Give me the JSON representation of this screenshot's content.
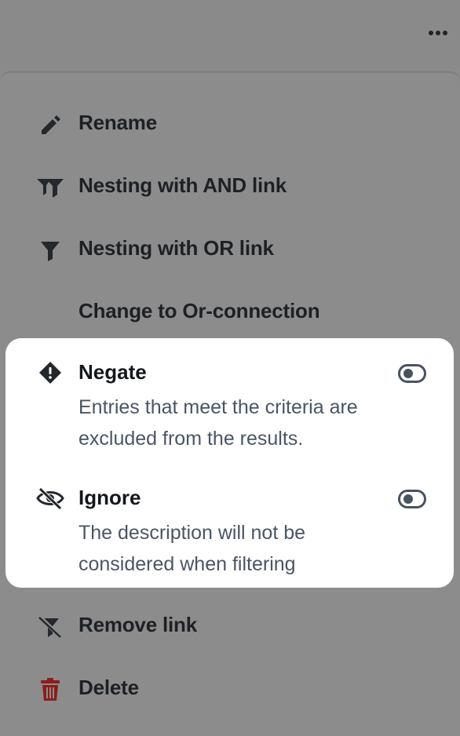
{
  "header": {
    "more_icon": "more-horizontal-icon"
  },
  "menu": {
    "items": [
      {
        "label": "Rename",
        "icon": "pencil-icon"
      },
      {
        "label": "Nesting with AND link",
        "icon": "double-filter-icon"
      },
      {
        "label": "Nesting with OR link",
        "icon": "filter-icon"
      },
      {
        "label": "Change to Or-connection",
        "icon": ""
      }
    ],
    "toggles": [
      {
        "title": "Negate",
        "description": "Entries that meet the criteria are excluded from the results.",
        "icon": "exclamation-diamond-icon",
        "enabled": false
      },
      {
        "title": "Ignore",
        "description": "The description will not be considered when filtering",
        "icon": "eye-slash-icon",
        "enabled": false
      }
    ],
    "bottom_items": [
      {
        "label": "Remove link",
        "icon": "filter-slash-icon"
      },
      {
        "label": "Delete",
        "icon": "trash-icon",
        "color": "#8c1d1a"
      }
    ]
  },
  "colors": {
    "overlay": "#8b8b8b",
    "text": "#1d2024",
    "secondary_text": "#4b5564",
    "delete": "#8c1d1a",
    "card": "#ffffff"
  }
}
